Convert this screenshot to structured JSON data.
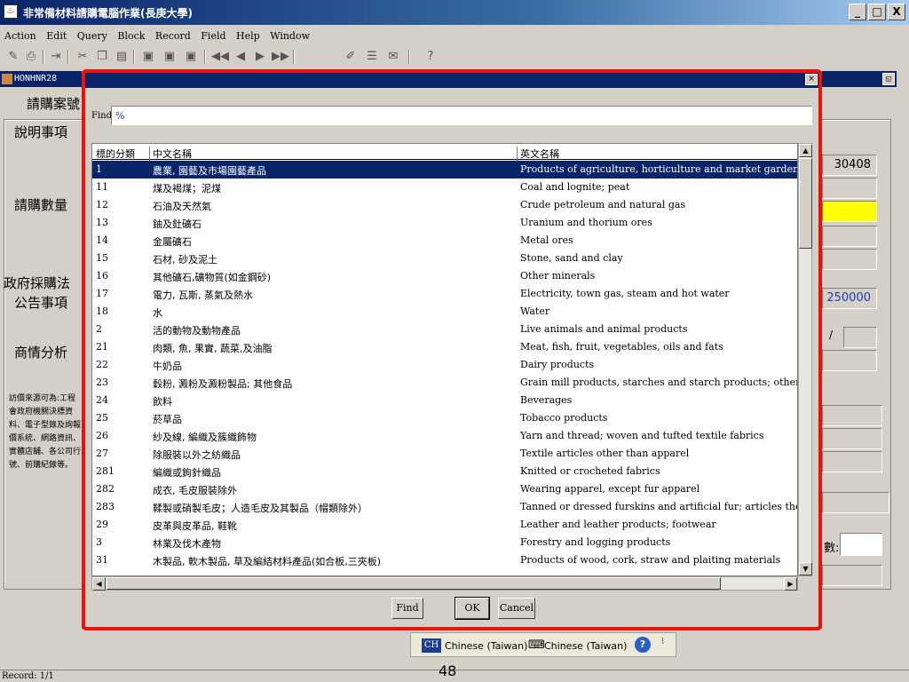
{
  "window": {
    "title": "非常備材料請購電腦作業(長庚大學)",
    "minimize": "_",
    "maximize": "□",
    "close": "X"
  },
  "menu": [
    "Action",
    "Edit",
    "Query",
    "Block",
    "Record",
    "Field",
    "Help",
    "Window"
  ],
  "toolbar": {
    "icons": [
      "open-icon",
      "print-icon",
      "exit-icon",
      "cut-icon",
      "copy-icon",
      "paste-icon",
      "insert-record-icon",
      "duplicate-record-icon",
      "delete-record-icon",
      "first-icon",
      "previous-icon",
      "next-icon",
      "last-icon",
      "edit-icon",
      "list-icon",
      "save-icon"
    ],
    "help": "?"
  },
  "form": {
    "title": "HONHNR28",
    "labels": {
      "case_no": "請購案號",
      "desc": "說明事項",
      "qty": "請購數量",
      "gov": "政府採購法",
      "notice": "公告事項",
      "market": "商情分析",
      "source": "訪價來源可為:工程會政府機關決標資料、電子型錄及詢報價系統、網路資訊、實體店舖、各公司行號、前購紀錄等。"
    },
    "values": {
      "code": "30408",
      "amount": "250000",
      "slash": "/",
      "count_label": "數:"
    }
  },
  "dialog": {
    "close": "×",
    "find_label": "Find",
    "find_value": "%",
    "columns": [
      "標的分類",
      "中文名稱",
      "英文名稱"
    ],
    "rows": [
      [
        "1",
        "農業, 園藝及市場園藝產品",
        "Products of agriculture, horticulture and market gardening"
      ],
      [
        "11",
        "煤及褐煤；泥煤",
        "Coal and lognite; peat"
      ],
      [
        "12",
        "石油及天然氣",
        "Crude petroleum and natural gas"
      ],
      [
        "13",
        "鈾及釷礦石",
        "Uranium and thorium ores"
      ],
      [
        "14",
        "金屬礦石",
        "Metal ores"
      ],
      [
        "15",
        "石材, 砂及泥土",
        "Stone, sand and clay"
      ],
      [
        "16",
        "其他礦石,礦物質(如金鋼砂)",
        "Other minerals"
      ],
      [
        "17",
        "電力, 瓦斯, 蒸氣及熱水",
        "Electricity, town gas, steam and hot water"
      ],
      [
        "18",
        "水",
        "Water"
      ],
      [
        "2",
        "活的動物及動物產品",
        "Live animals and animal products"
      ],
      [
        "21",
        "肉類, 魚, 果實, 蔬菜,及油脂",
        "Meat, fish, fruit, vegetables, oils and fats"
      ],
      [
        "22",
        "牛奶品",
        "Dairy products"
      ],
      [
        "23",
        "穀粉, 澱粉及澱粉製品; 其他食品",
        "Grain mill products, starches and starch products; other food produ"
      ],
      [
        "24",
        "飲料",
        "Beverages"
      ],
      [
        "25",
        "菸草品",
        "Tobacco products"
      ],
      [
        "26",
        "紗及線, 編織及簇織飾物",
        "Yarn and thread; woven and tufted textile fabrics"
      ],
      [
        "27",
        "除服裝以外之紡織品",
        "Textile articles other than apparel"
      ],
      [
        "281",
        "編織或鉤針織品",
        "Knitted or crocheted fabrics"
      ],
      [
        "282",
        "成衣, 毛皮服裝除外",
        "Wearing apparel, except fur apparel"
      ],
      [
        "283",
        "鞣製或硝製毛皮；人造毛皮及其製品（帽類除外）",
        "Tanned or dressed furskins and artificial fur; articles thereof (excep"
      ],
      [
        "29",
        "皮革與皮革品, 鞋靴",
        "Leather and leather products; footwear"
      ],
      [
        "3",
        "林業及伐木產物",
        "Forestry and logging products"
      ],
      [
        "31",
        "木製品, 軟木製品, 草及編結材料產品(如合板,三夾板)",
        "Products of wood, cork, straw and plaiting materials"
      ]
    ],
    "buttons": {
      "find": "Find",
      "ok": "OK",
      "cancel": "Cancel"
    }
  },
  "langbar": {
    "ch": "CH",
    "lang1": "Chinese (Taiwan)",
    "lang2": "Chinese (Taiwan)"
  },
  "status": {
    "record": "Record: 1/1"
  },
  "page_number": "48"
}
